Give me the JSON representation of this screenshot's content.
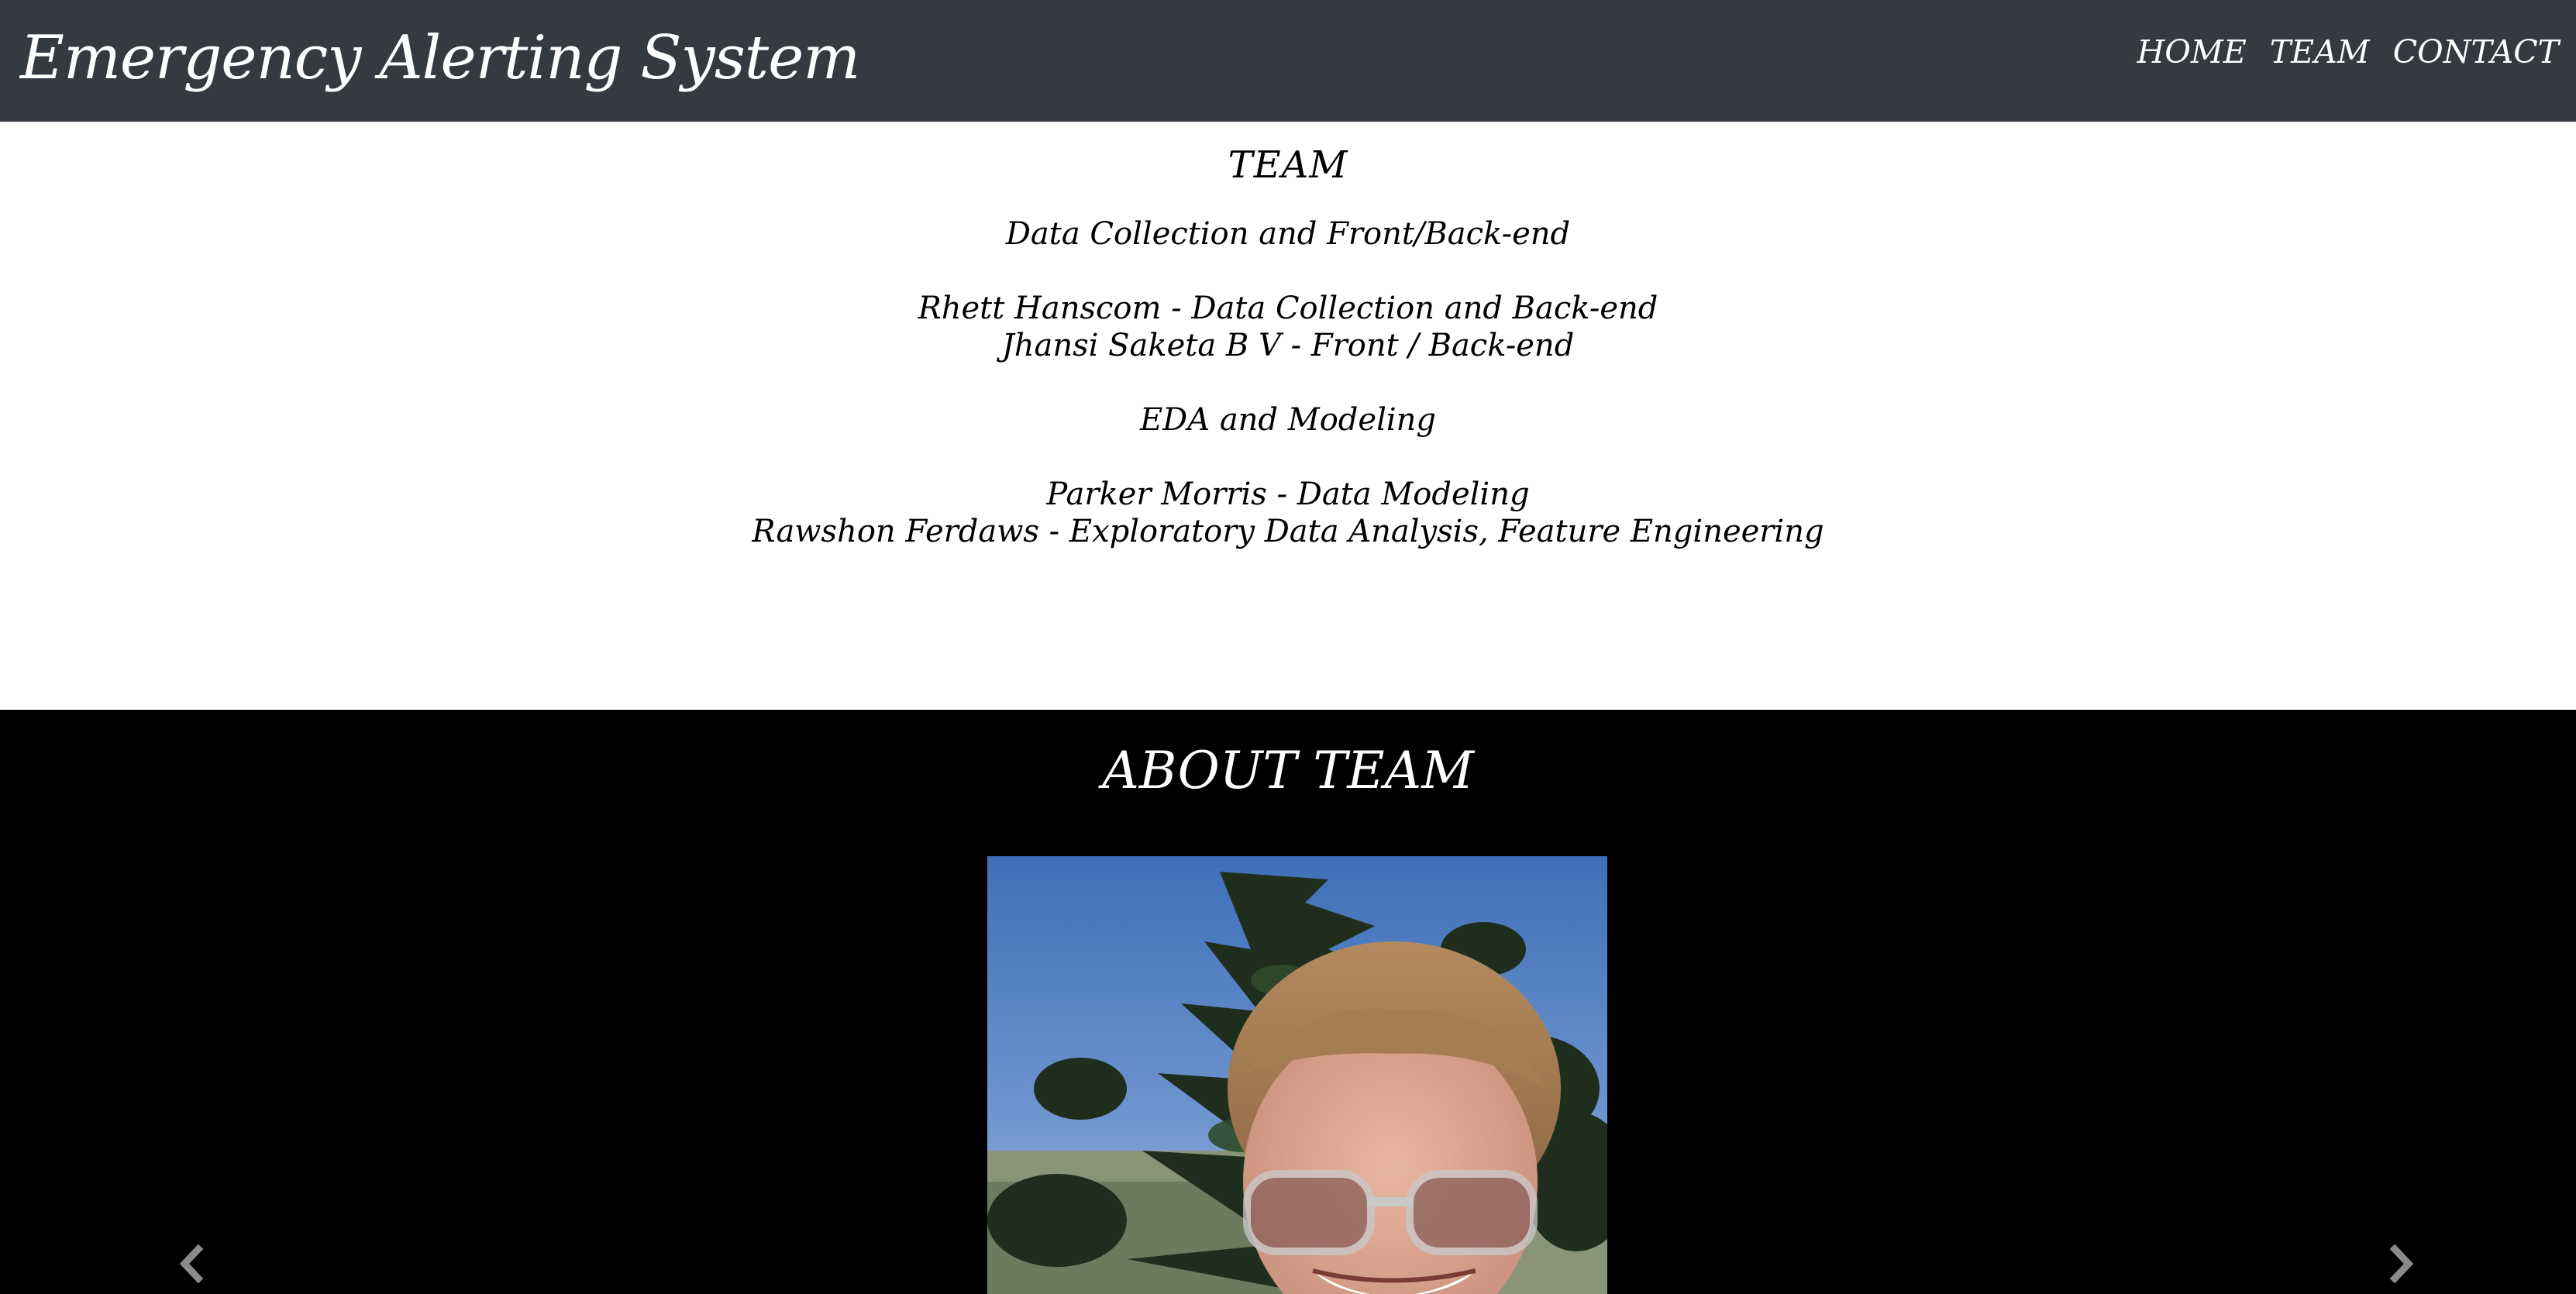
{
  "header": {
    "brand": "Emergency Alerting System",
    "nav": [
      "HOME",
      "TEAM",
      "CONTACT"
    ]
  },
  "team": {
    "title": "TEAM",
    "group1_heading": "Data Collection and Front/Back-end",
    "group1_members": [
      "Rhett Hanscom - Data Collection and Back-end",
      "Jhansi Saketa B V - Front / Back-end"
    ],
    "group2_heading": "EDA and Modeling",
    "group2_members": [
      "Parker Morris - Data Modeling",
      "Rawshon Ferdaws - Exploratory Data Analysis, Feature Engineering"
    ]
  },
  "about": {
    "title": "ABOUT TEAM",
    "prev_icon": "chevron-left-icon",
    "next_icon": "chevron-right-icon"
  },
  "colors": {
    "navbar": "#343a40",
    "about_bg": "#000000",
    "text_light": "#ffffff",
    "text_dark": "#000000",
    "arrow": "#8a8a8a"
  }
}
